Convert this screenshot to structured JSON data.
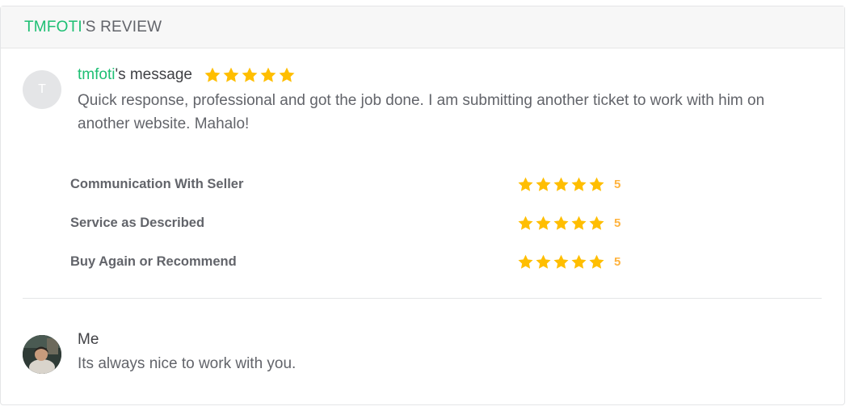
{
  "header": {
    "user": "TMFOTI",
    "suffix": "'S REVIEW"
  },
  "review": {
    "avatar_initial": "T",
    "username": "tmfoti",
    "message_suffix": "'s message",
    "overall_stars": 5,
    "text": "Quick response, professional and got the job done. I am submitting another ticket to work with him on another website. Mahalo!"
  },
  "ratings": [
    {
      "label": "Communication With Seller",
      "stars": 5,
      "value": "5"
    },
    {
      "label": "Service as Described",
      "stars": 5,
      "value": "5"
    },
    {
      "label": "Buy Again or Recommend",
      "stars": 5,
      "value": "5"
    }
  ],
  "reply": {
    "name": "Me",
    "text": "Its always nice to work with you."
  },
  "colors": {
    "accent_green": "#1dbf73",
    "star_color": "#ffbe00",
    "rating_value": "#ffb33e",
    "text_dark": "#404145",
    "text_muted": "#62646a"
  }
}
